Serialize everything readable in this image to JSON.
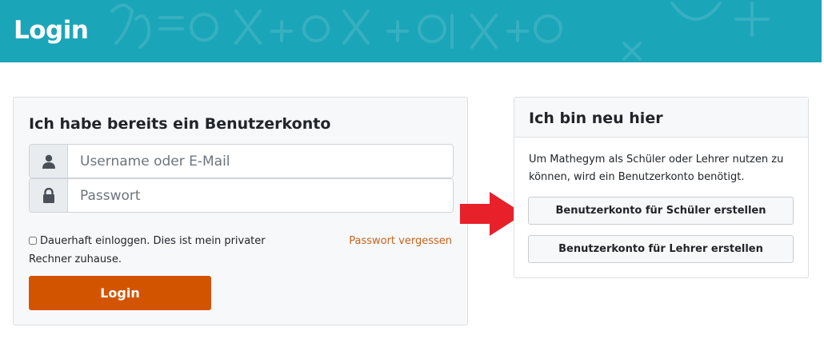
{
  "header": {
    "title": "Login"
  },
  "login_card": {
    "heading": "Ich habe bereits ein Benutzerkonto",
    "username_placeholder": "Username oder E-Mail",
    "password_placeholder": "Passwort",
    "remember_label": "Dauerhaft einloggen. Dies ist mein privater Rechner zuhause.",
    "remember_checked": false,
    "forgot_link": "Passwort vergessen",
    "login_button": "Login",
    "accent_color": "#d35400"
  },
  "new_card": {
    "heading": "Ich bin neu hier",
    "description": "Um Mathegym als Schüler oder Lehrer nutzen zu können, wird ein Benutzerkonto benötigt.",
    "student_button": "Benutzerkonto für Schüler erstellen",
    "teacher_button": "Benutzerkonto für Lehrer erstellen"
  },
  "icons": {
    "username": "user-icon",
    "password": "lock-icon",
    "pointer": "arrow-right-icon"
  },
  "colors": {
    "header_bg": "#1ba5b9",
    "arrow": "#e8202a"
  }
}
